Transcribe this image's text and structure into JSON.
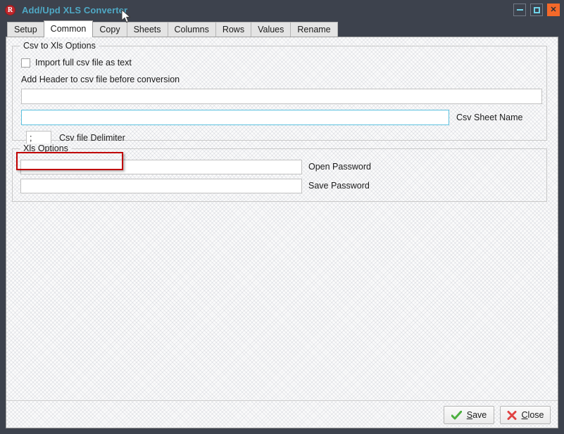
{
  "window": {
    "title": "Add/Upd XLS Converter",
    "icon": "app-r-icon",
    "icon_letter": "R",
    "accent_title_color": "#4fa8c4",
    "titlebar_color": "#3d424d",
    "controls": {
      "minimize": "minimize-icon",
      "maximize": "maximize-icon",
      "close": "close-icon",
      "close_glyph": "✕",
      "close_color": "#f4692a"
    }
  },
  "tabs": [
    {
      "label": "Setup",
      "active": false
    },
    {
      "label": "Common",
      "active": true
    },
    {
      "label": "Copy",
      "active": false
    },
    {
      "label": "Sheets",
      "active": false
    },
    {
      "label": "Columns",
      "active": false
    },
    {
      "label": "Rows",
      "active": false
    },
    {
      "label": "Values",
      "active": false
    },
    {
      "label": "Rename",
      "active": false
    }
  ],
  "csv_group": {
    "title": "Csv to Xls Options",
    "import_full_csv": {
      "label": "Import full csv file as text",
      "checked": false
    },
    "add_header_label": "Add Header to csv file before conversion",
    "header_input": {
      "value": "",
      "placeholder": ""
    },
    "sheet_name_input": {
      "value": "",
      "placeholder": "",
      "focused": true
    },
    "sheet_name_label": "Csv Sheet Name",
    "delimiter_input": {
      "value": ";",
      "placeholder": ""
    },
    "delimiter_label": "Csv file Delimiter",
    "highlight_color": "#c00000"
  },
  "xls_group": {
    "title": "Xls Options",
    "open_password_input": {
      "value": "",
      "placeholder": ""
    },
    "open_password_label": "Open Password",
    "save_password_input": {
      "value": "",
      "placeholder": ""
    },
    "save_password_label": "Save Password"
  },
  "buttons": {
    "save": {
      "label": "Save",
      "accel": "S",
      "icon": "check-icon",
      "icon_color": "#4caf3f"
    },
    "close": {
      "label": "Close",
      "accel": "C",
      "icon": "cross-icon",
      "icon_color": "#e04343"
    }
  }
}
